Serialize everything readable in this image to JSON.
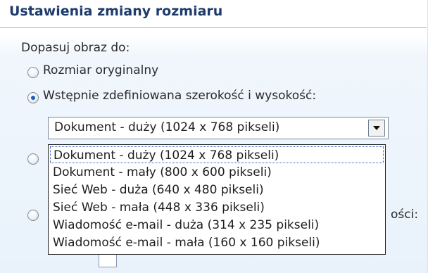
{
  "section": {
    "title": "Ustawienia zmiany rozmiaru"
  },
  "fit": {
    "label": "Dopasuj obraz do:",
    "options": [
      {
        "label": "Rozmiar oryginalny",
        "checked": false
      },
      {
        "label": "Wstępnie zdefiniowana szerokość i wysokość:",
        "checked": true
      },
      {
        "label": "",
        "checked": false
      },
      {
        "label": "ości:",
        "checked": false
      }
    ]
  },
  "preset_combo": {
    "value": "Dokument - duży (1024 x 768 pikseli)",
    "selected_index": 0,
    "options": [
      "Dokument - duży (1024 x 768 pikseli)",
      "Dokument - mały (800 x 600 pikseli)",
      "Sieć Web - duża (640 x 480 pikseli)",
      "Sieć Web - mała (448 x 336 pikseli)",
      "Wiadomość e-mail - duża (314 x 235 pikseli)",
      "Wiadomość e-mail - mała (160 x 160 pikseli)"
    ]
  },
  "colors": {
    "header_text": "#1d3b6b",
    "radio_checked": "#1e5fb8",
    "dropdown_border": "#222222",
    "focus_outline": "#2b5bb7"
  }
}
